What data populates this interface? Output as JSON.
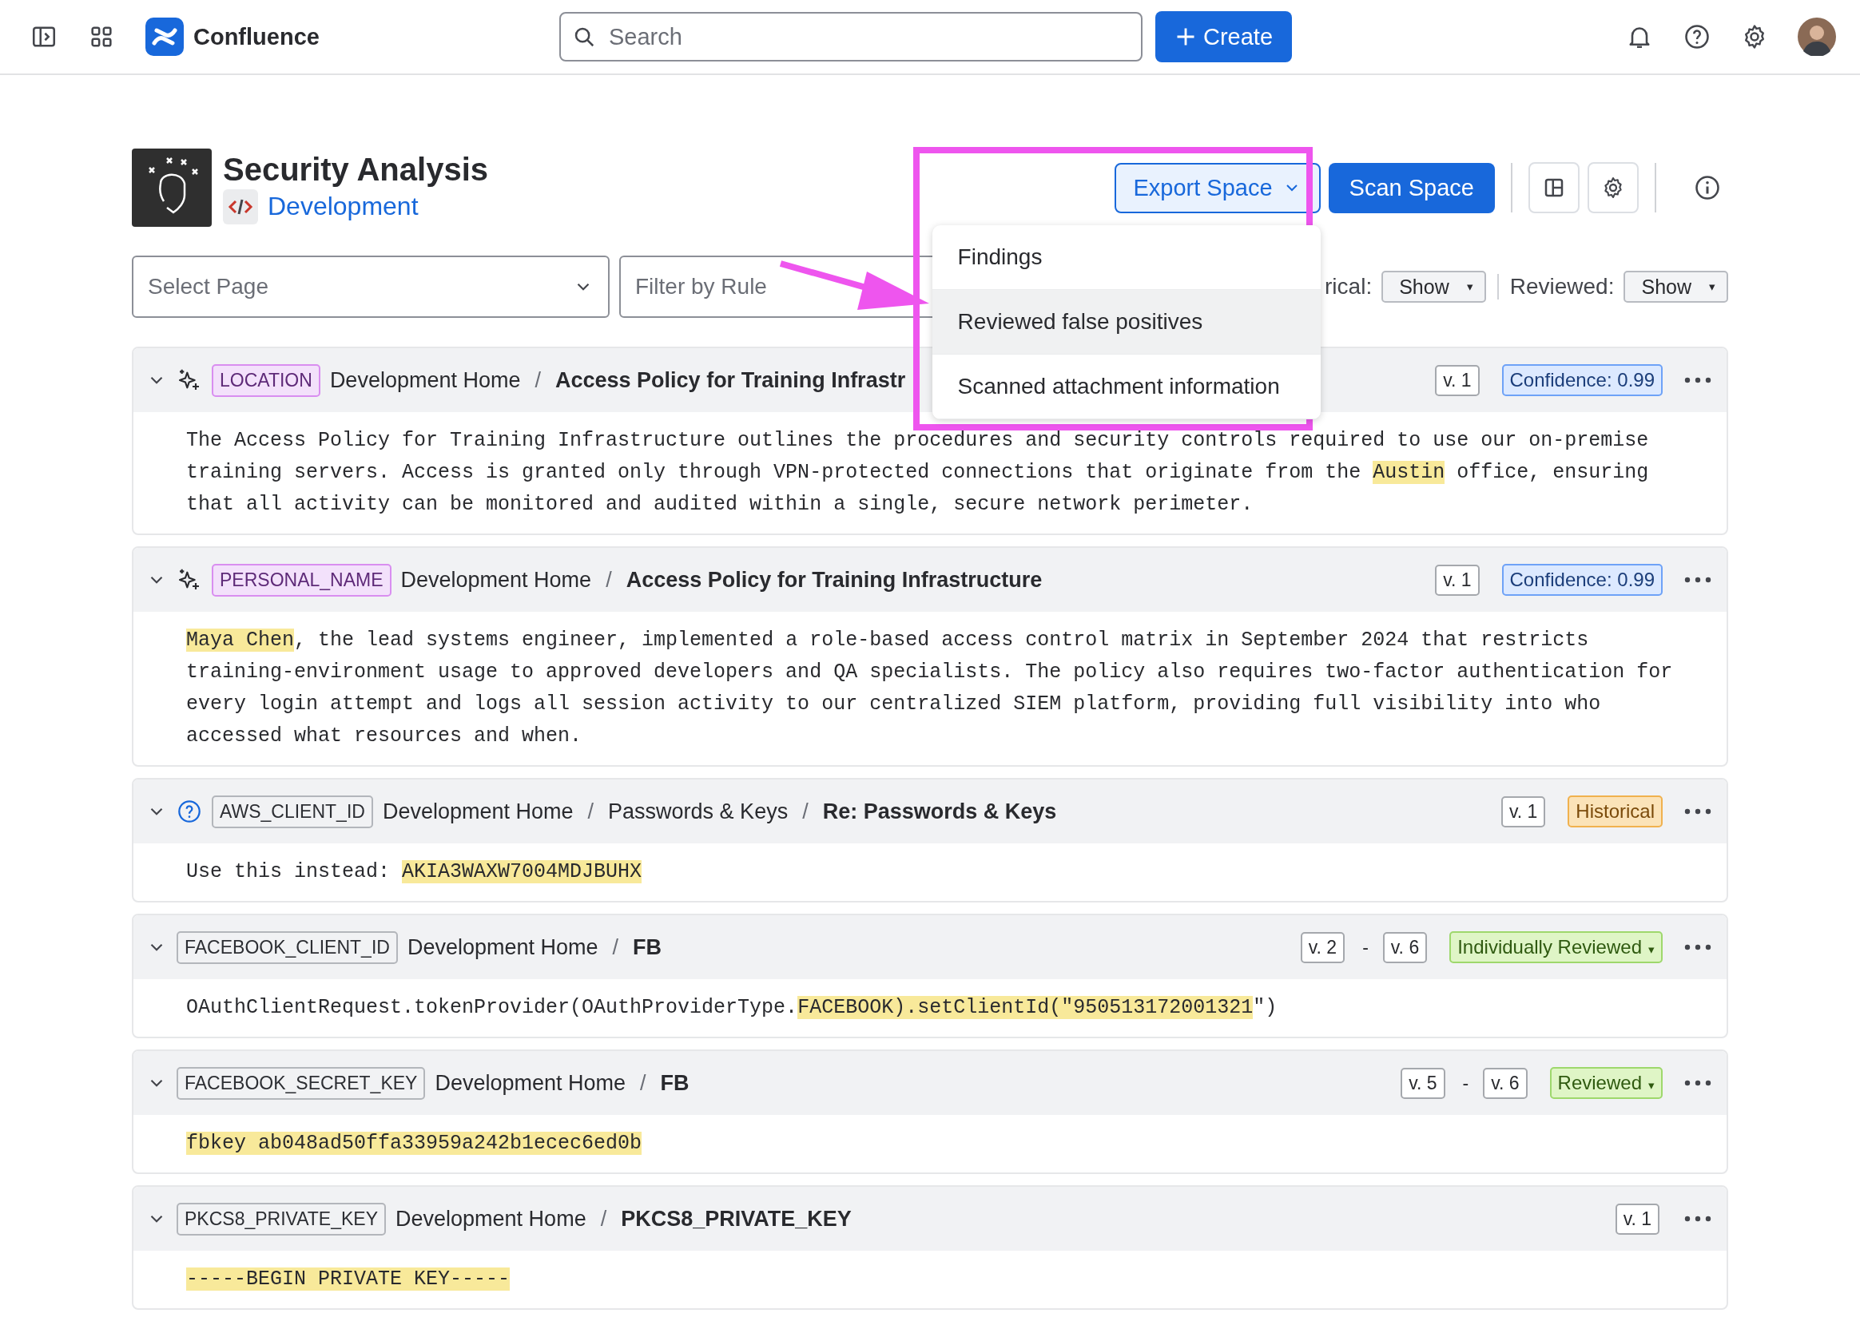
{
  "top_bar": {
    "product": "Confluence",
    "search": {
      "placeholder": "Search"
    },
    "create_button": "Create"
  },
  "space": {
    "title": "Security Analysis",
    "category": "Development"
  },
  "actions": {
    "export_button": "Export Space",
    "scan_button": "Scan Space"
  },
  "export_menu": {
    "items": [
      {
        "label": "Findings",
        "selected": false
      },
      {
        "label": "Reviewed false positives",
        "selected": true
      },
      {
        "label": "Scanned attachment information",
        "selected": false
      }
    ]
  },
  "filters": {
    "page_select": {
      "placeholder": "Select Page"
    },
    "rule_filter": {
      "placeholder": "Filter by Rule"
    },
    "historical": {
      "label": "rical:",
      "value": "Show",
      "caret": "▾"
    },
    "reviewed": {
      "label": "Reviewed:",
      "value": "Show",
      "caret": "▾"
    }
  },
  "findings": [
    {
      "expanded": true,
      "kind": "detected",
      "rule": "LOCATION",
      "color": "#f3e1fb",
      "path": [
        {
          "text": "Development Home",
          "bold": false
        },
        {
          "text": "/",
          "bold": false
        },
        {
          "text": "Access Policy for Training Infrastr",
          "bold": true
        }
      ],
      "versions": [
        {
          "kind": "version",
          "text": "v. 1"
        }
      ],
      "status": {
        "kind": "confidence",
        "label": "Confidence: 0.99"
      },
      "body": [
        {
          "text": "The Access Policy for Training Infrastructure outlines the procedures and security controls required to use our on-premise training servers. Access is granted only through VPN-protected connections that originate from the ",
          "highlight": false
        },
        {
          "text": "Austin",
          "highlight": true
        },
        {
          "text": " office, ensuring that all activity can be monitored and audited within a single, secure network perimeter.",
          "highlight": false
        }
      ]
    },
    {
      "expanded": true,
      "kind": "detected",
      "rule": "PERSONAL_NAME",
      "color": "#f3e1fb",
      "path": [
        {
          "text": "Development Home",
          "bold": false
        },
        {
          "text": "/",
          "bold": false
        },
        {
          "text": "Access Policy for Training Infrastructure",
          "bold": true
        }
      ],
      "versions": [
        {
          "kind": "version",
          "text": "v. 1"
        }
      ],
      "status": {
        "kind": "confidence",
        "label": "Confidence: 0.99"
      },
      "body": [
        {
          "text": "Maya Chen",
          "highlight": true
        },
        {
          "text": ", the lead systems engineer, implemented a role-based access control matrix in September 2024 that restricts training-environment usage to approved developers and QA specialists. The policy also requires two-factor authentication for every login attempt and logs all session activity to our centralized SIEM platform, providing full visibility into who accessed what resources and when.",
          "highlight": false
        }
      ]
    },
    {
      "expanded": true,
      "kind": "unverified",
      "rule": "AWS_CLIENT_ID",
      "color": "#f1f2f4",
      "path": [
        {
          "text": "Development Home",
          "bold": false
        },
        {
          "text": "/",
          "bold": false
        },
        {
          "text": "Passwords & Keys",
          "bold": false
        },
        {
          "text": "/",
          "bold": false
        },
        {
          "text": "Re: Passwords & Keys",
          "bold": true
        }
      ],
      "versions": [
        {
          "kind": "version",
          "text": "v. 1"
        }
      ],
      "status": {
        "kind": "historical",
        "label": "Historical"
      },
      "body": [
        {
          "text": "Use this instead: ",
          "highlight": false
        },
        {
          "text": "AKIA3WAXW7004MDJBUHX",
          "highlight": true
        }
      ]
    },
    {
      "expanded": true,
      "kind": "plain",
      "rule": "FACEBOOK_CLIENT_ID",
      "color": "#f1f2f4",
      "path": [
        {
          "text": "Development Home",
          "bold": false
        },
        {
          "text": "/",
          "bold": false
        },
        {
          "text": "FB",
          "bold": true
        }
      ],
      "versions": [
        {
          "kind": "version",
          "text": "v. 2"
        },
        {
          "kind": "separator",
          "text": "-"
        },
        {
          "kind": "version",
          "text": "v. 6"
        }
      ],
      "status": {
        "kind": "reviewed",
        "label": "Individually Reviewed",
        "caret": "▾"
      },
      "body": [
        {
          "text": "OAuthClientRequest.tokenProvider(OAuthProviderType.",
          "highlight": false
        },
        {
          "text": "FACEBOOK).setClientId(\"950513172001321",
          "highlight": true
        },
        {
          "text": "\")",
          "highlight": false
        }
      ]
    },
    {
      "expanded": true,
      "kind": "plain",
      "rule": "FACEBOOK_SECRET_KEY",
      "color": "#f1f2f4",
      "path": [
        {
          "text": "Development Home",
          "bold": false
        },
        {
          "text": "/",
          "bold": false
        },
        {
          "text": "FB",
          "bold": true
        }
      ],
      "versions": [
        {
          "kind": "version",
          "text": "v. 5"
        },
        {
          "kind": "separator",
          "text": "-"
        },
        {
          "kind": "version",
          "text": "v. 6"
        }
      ],
      "status": {
        "kind": "reviewed",
        "label": "Reviewed",
        "caret": "▾"
      },
      "body": [
        {
          "text": "fbkey ab048ad50ffa33959a242b1ecec6ed0b",
          "highlight": true
        }
      ]
    },
    {
      "expanded": true,
      "kind": "plain",
      "rule": "PKCS8_PRIVATE_KEY",
      "color": "#f1f2f4",
      "path": [
        {
          "text": "Development Home",
          "bold": false
        },
        {
          "text": "/",
          "bold": false
        },
        {
          "text": "PKCS8_PRIVATE_KEY",
          "bold": true
        }
      ],
      "versions": [
        {
          "kind": "version",
          "text": "v. 1"
        }
      ],
      "body": [
        {
          "text": "-----BEGIN PRIVATE KEY-----",
          "highlight": true
        }
      ]
    }
  ]
}
